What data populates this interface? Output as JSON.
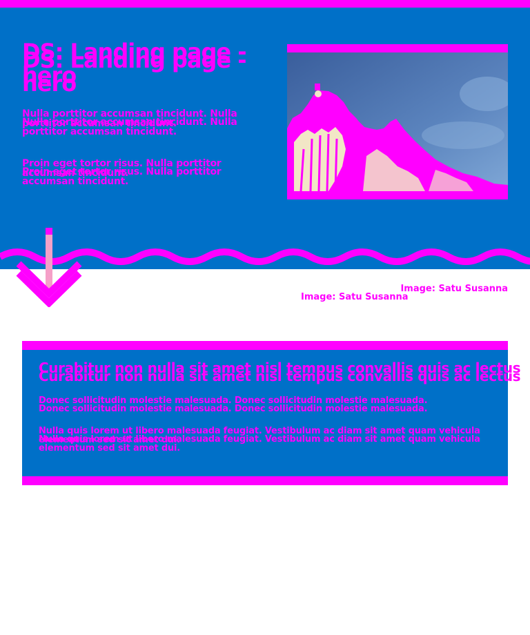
{
  "colors": {
    "background": "#0070C8",
    "accent": "#FF00FF",
    "page": "#FFFFFF",
    "arrow_stem": "#F5A0C8"
  },
  "hero": {
    "title": "DS: Landing page - hero",
    "paragraphs": [
      "Nulla porttitor accumsan tincidunt. Nulla porttitor accumsan tincidunt.",
      "Proin eget tortor risus. Nulla porttitor accumsan tincidunt."
    ],
    "image_alt": "building-dome-photo",
    "image_caption": "Image: Satu Susanna",
    "scroll_icon": "arrow-down-icon"
  },
  "card": {
    "title": "Curabitur non nulla sit amet nisl tempus convallis quis ac lectus",
    "paragraphs": [
      "Donec sollicitudin molestie malesuada. Donec sollicitudin molestie malesuada.",
      "Nulla quis lorem ut libero malesuada feugiat. Vestibulum ac diam sit amet quam vehicula elementum sed sit amet dui."
    ]
  }
}
